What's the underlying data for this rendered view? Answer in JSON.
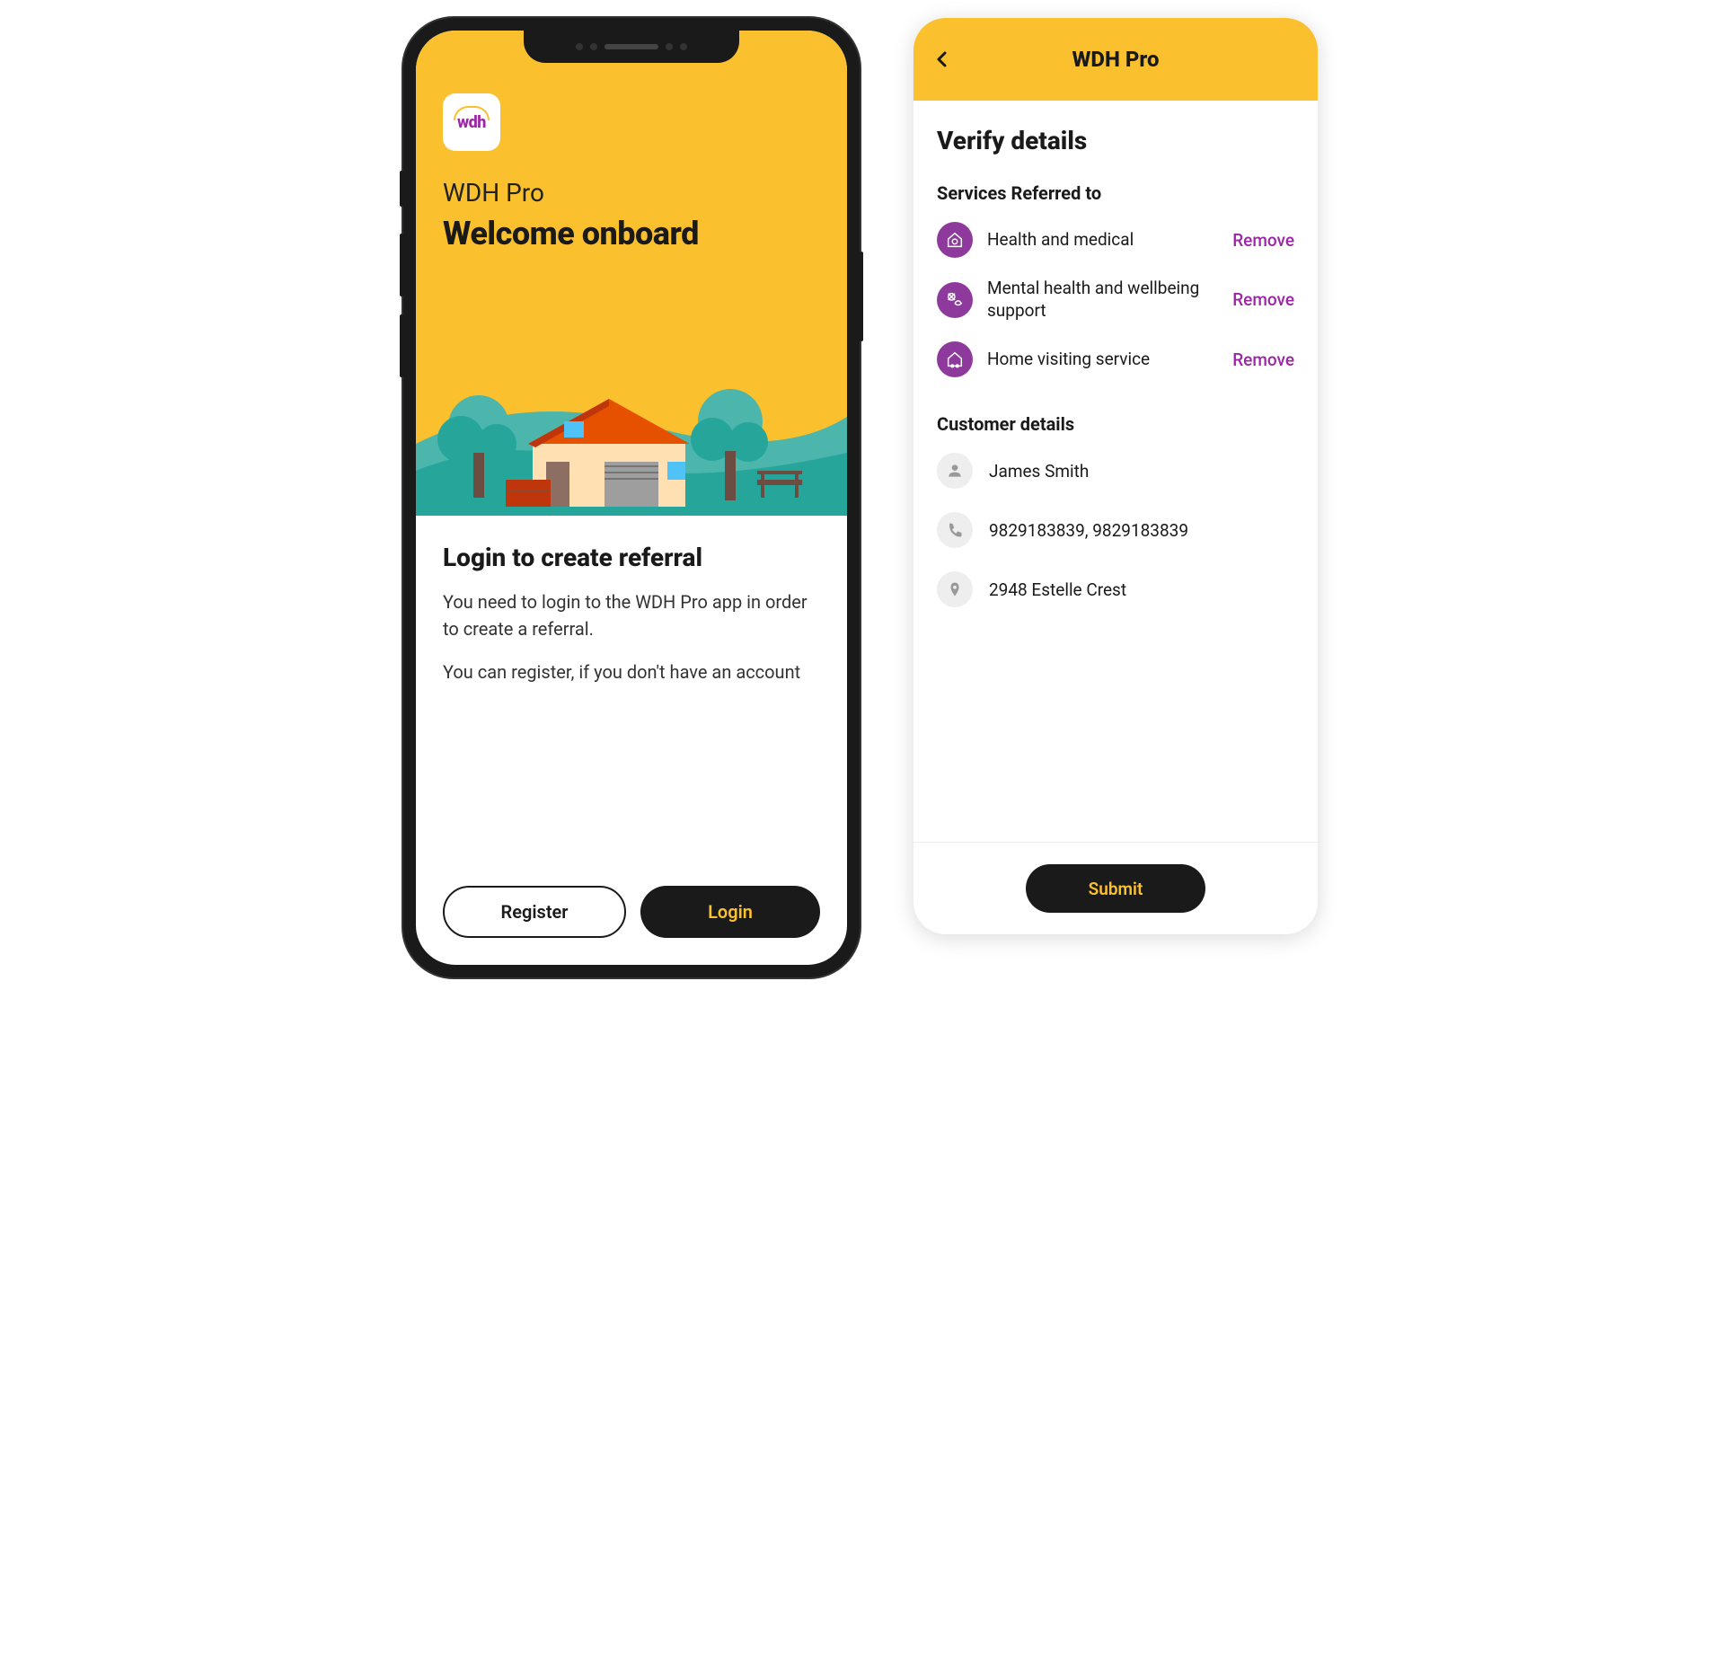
{
  "brand": {
    "logo_text": "wdh"
  },
  "screen1": {
    "title_small": "WDH Pro",
    "title_large": "Welcome onboard",
    "login_heading": "Login to create referral",
    "login_text_1": "You need to login to the WDH Pro app in order to create a referral.",
    "login_text_2": "You can register, if you don't have an account",
    "register_label": "Register",
    "login_label": "Login"
  },
  "screen2": {
    "header_title": "WDH Pro",
    "verify_heading": "Verify details",
    "services_label": "Services Referred to",
    "services": [
      {
        "label": "Health and medical",
        "remove": "Remove"
      },
      {
        "label": "Mental health and wellbeing support",
        "remove": "Remove"
      },
      {
        "label": "Home visiting service",
        "remove": "Remove"
      }
    ],
    "customer_label": "Customer details",
    "customer": {
      "name": "James Smith",
      "phone": "9829183839,  9829183839",
      "address": "2948 Estelle Crest"
    },
    "submit_label": "Submit"
  },
  "colors": {
    "accent": "#fbc02d",
    "purple": "#9b27a5",
    "dark": "#1a1a1a"
  }
}
